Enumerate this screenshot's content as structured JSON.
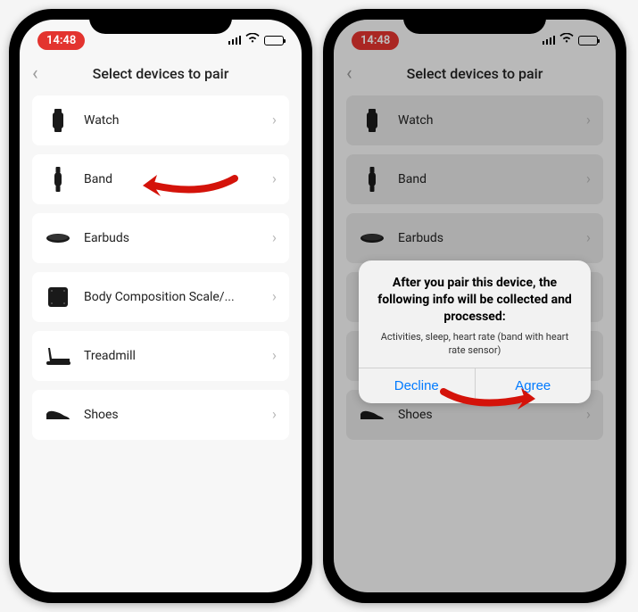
{
  "status": {
    "time": "14:48"
  },
  "header": {
    "title": "Select devices to pair"
  },
  "devices": [
    {
      "label": "Watch"
    },
    {
      "label": "Band"
    },
    {
      "label": "Earbuds"
    },
    {
      "label": "Body Composition Scale/..."
    },
    {
      "label": "Treadmill"
    },
    {
      "label": "Shoes"
    }
  ],
  "modal": {
    "title": "After you pair this device, the following info will be collected and processed:",
    "detail": "Activities, sleep, heart rate (band with heart rate sensor)",
    "decline": "Decline",
    "agree": "Agree"
  }
}
